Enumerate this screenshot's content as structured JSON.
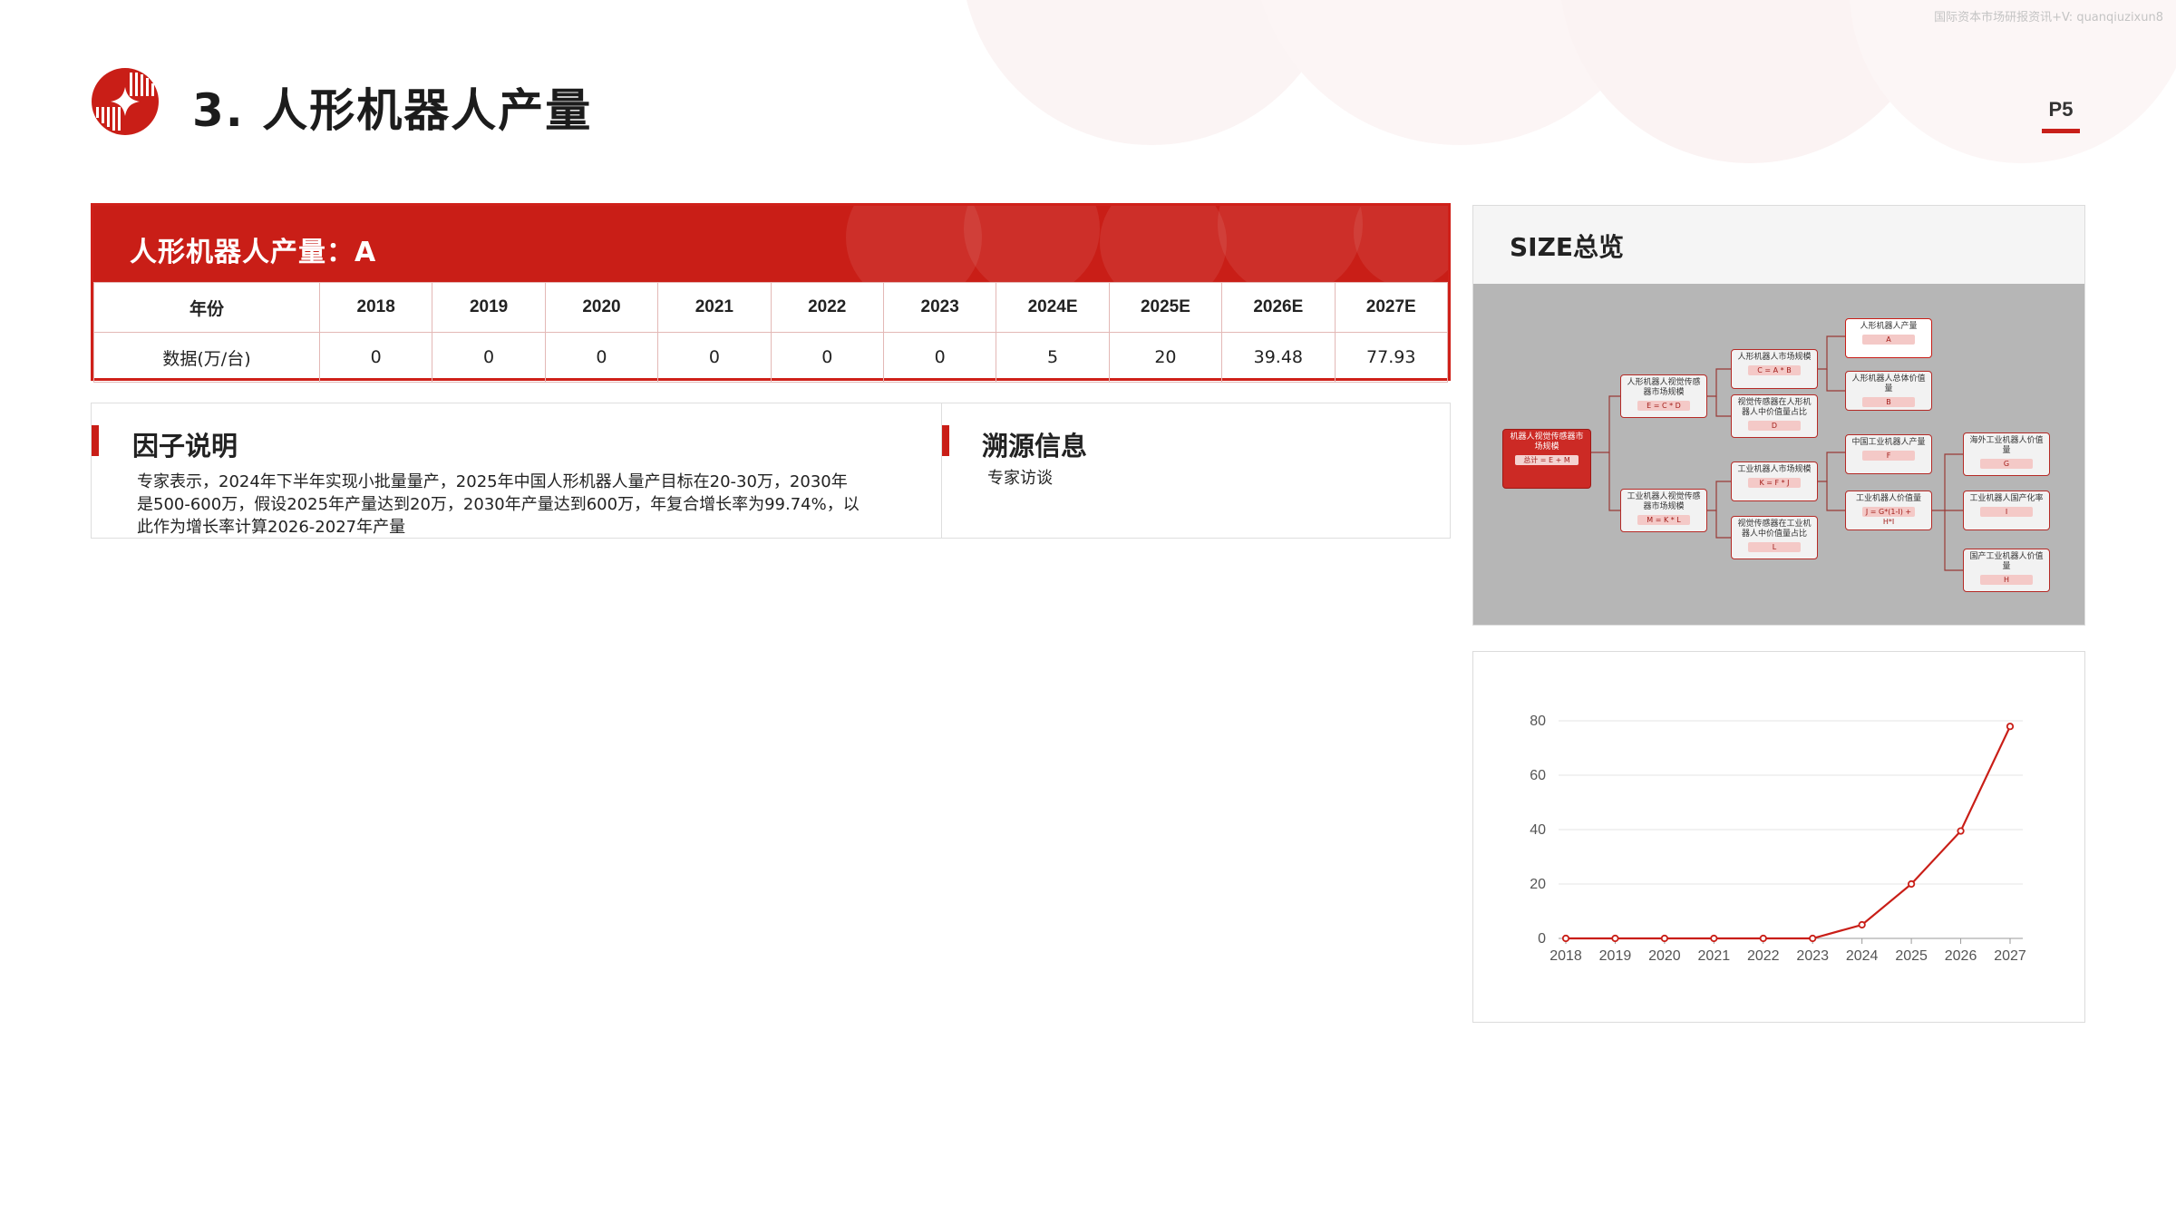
{
  "watermark": "国际资本市场研报资讯+V: quanqiuzixun8",
  "page": {
    "title": "3.  人形机器人产量",
    "number": "P5"
  },
  "production_table": {
    "title": "人形机器人产量：A",
    "header_label": "年份",
    "row_label": "数据(万/台)",
    "years": [
      "2018",
      "2019",
      "2020",
      "2021",
      "2022",
      "2023",
      "2024E",
      "2025E",
      "2026E",
      "2027E"
    ],
    "values": [
      "0",
      "0",
      "0",
      "0",
      "0",
      "0",
      "5",
      "20",
      "39.48",
      "77.93"
    ]
  },
  "factor": {
    "heading": "因子说明",
    "text_lines": [
      "专家表示，2024年下半年实现小批量量产，2025年中国人形机器人量产目标在20-30万，2030年",
      "是500-600万，假设2025年产量达到20万，2030年产量达到600万，年复合增长率为99.74%，以",
      "此作为增长率计算2026-2027年产量"
    ]
  },
  "source": {
    "heading": "溯源信息",
    "text": "专家访谈"
  },
  "size_overview": {
    "title": "SIZE总览",
    "nodes": {
      "root": {
        "label": "机器人视觉传感器市场规模",
        "tag": "总计 = E + M"
      },
      "humanoid_vision": {
        "label": "人形机器人视觉传感器市场规模",
        "tag": "E = C * D"
      },
      "industrial_vision": {
        "label": "工业机器人视觉传感器市场规模",
        "tag": "M = K * L"
      },
      "humanoid_market": {
        "label": "人形机器人市场规模",
        "tag": "C = A * B"
      },
      "humanoid_share": {
        "label": "视觉传感器在人形机器人中价值量占比",
        "tag": "D"
      },
      "industrial_market": {
        "label": "工业机器人市场规模",
        "tag": "K = F * J"
      },
      "industrial_share": {
        "label": "视觉传感器在工业机器人中价值量占比",
        "tag": "L"
      },
      "humanoid_output": {
        "label": "人形机器人产量",
        "tag": "A"
      },
      "humanoid_value": {
        "label": "人形机器人总体价值量",
        "tag": "B"
      },
      "china_industrial_output": {
        "label": "中国工业机器人产量",
        "tag": "F"
      },
      "industrial_value": {
        "label": "工业机器人价值量",
        "tag": "J = G*(1-I) + H*I"
      },
      "overseas_value": {
        "label": "海外工业机器人价值量",
        "tag": "G"
      },
      "localization_rate": {
        "label": "工业机器人国产化率",
        "tag": "I"
      },
      "domestic_value": {
        "label": "国产工业机器人价值量",
        "tag": "H"
      }
    }
  },
  "chart_data": {
    "type": "line",
    "categories": [
      "2018",
      "2019",
      "2020",
      "2021",
      "2022",
      "2023",
      "2024",
      "2025",
      "2026",
      "2027"
    ],
    "series": [
      {
        "values": [
          0,
          0,
          0,
          0,
          0,
          0,
          5,
          20,
          39.48,
          77.93
        ]
      }
    ],
    "y_ticks": [
      "0",
      "20",
      "40",
      "60",
      "80"
    ],
    "ylim": [
      0,
      80
    ],
    "grid": true,
    "colors": {
      "line": "#c91e17",
      "grid": "#e6e6e6"
    }
  }
}
